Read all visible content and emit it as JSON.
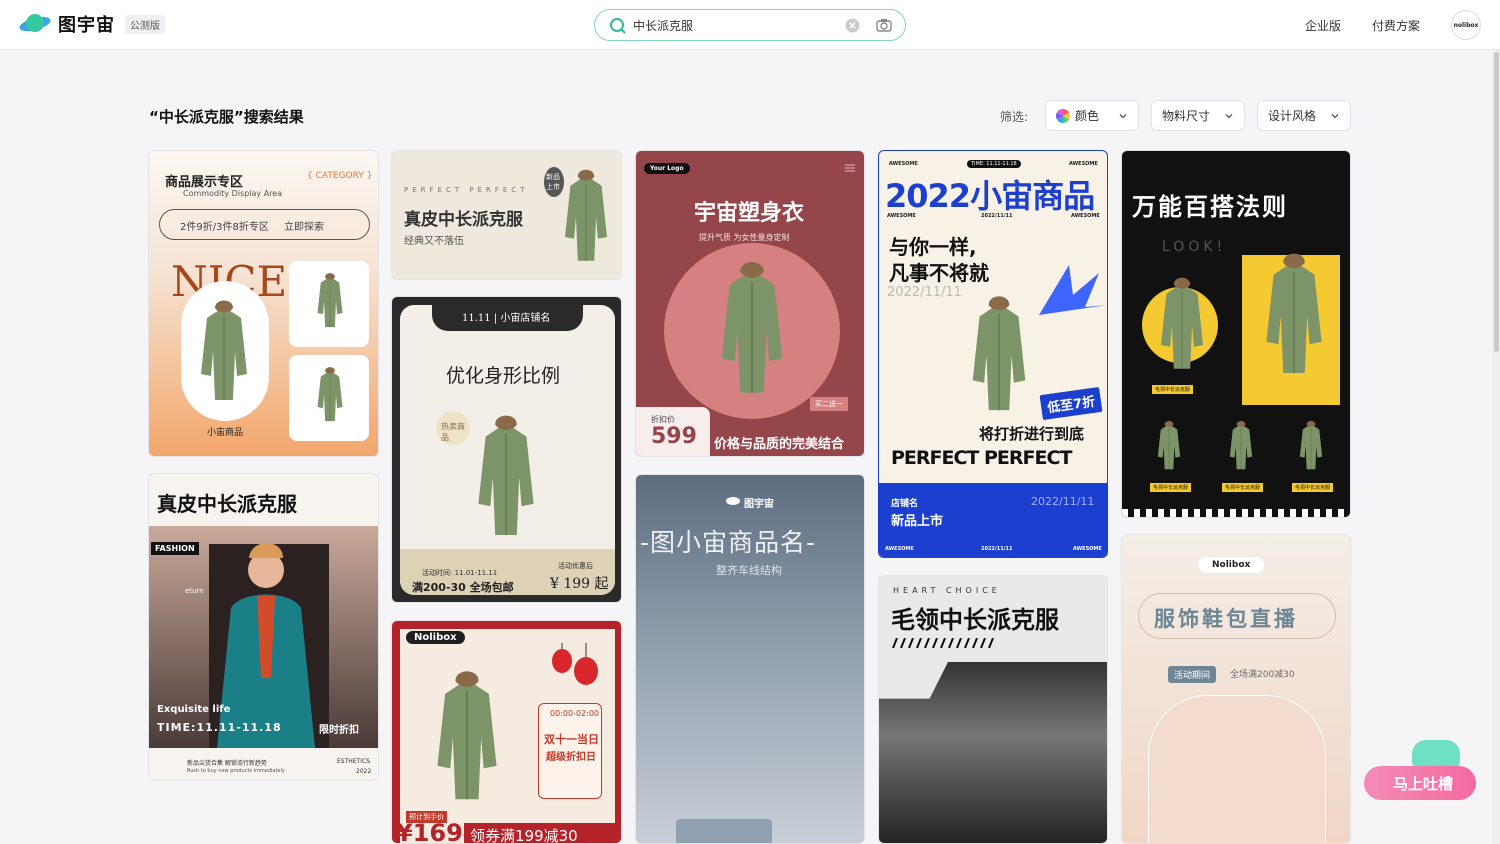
{
  "header": {
    "logo_text": "图宇宙",
    "beta_badge": "公测版",
    "search_value": "中长派克服",
    "nav_enterprise": "企业版",
    "nav_pricing": "付费方案",
    "avatar_text": "nolibox"
  },
  "results": {
    "title": "“中长派克服”搜索结果",
    "filter_label": "筛选:",
    "filters": [
      "颜色",
      "物料尺寸",
      "设计风格"
    ]
  },
  "cards": {
    "c1": {
      "heading": "商品展示专区",
      "sub": "Commodity Display Area",
      "category": "{ CATEGORY }",
      "pill_left": "2件9折/3件8折专区",
      "pill_right": "立即探索",
      "big": "NICE",
      "label": "小宙商品"
    },
    "c2": {
      "top": "PERFECT PERFECT",
      "heading": "真皮中长派克服",
      "sub": "经典又不落伍",
      "badge": "新品上市"
    },
    "c3": {
      "banner": "11.11 | 小宙店铺名",
      "heading": "优化身形比例",
      "tag": "热卖商品",
      "time": "活动时间: 11.01-11.11",
      "offer": "满200-30 全场包邮",
      "after": "活动优惠后",
      "price": "¥ 199 起"
    },
    "c4": {
      "brand": "Nolibox",
      "timer": "00:00-02:00",
      "line1": "双十一当日",
      "line2": "超级折扣日",
      "est": "预计到手价",
      "price": "¥169",
      "coupon": "领券满199减30"
    },
    "c5": {
      "logo": "Your Logo",
      "heading": "宇宙塑身衣",
      "sub": "提升气质 为女性量身定制",
      "tag": "买二送一",
      "price_label": "折扣价",
      "price": "599",
      "slogan": "价格与品质的完美结合"
    },
    "c6": {
      "brand": "图宇宙",
      "heading": "-图小宙商品名-",
      "sub": "整齐车线结构"
    },
    "c7": {
      "aw1": "AWESOME",
      "time": "TIME: 11.11-11.18",
      "aw2": "AWESOME",
      "heading": "2022小宙商品",
      "aw3": "AWESOME",
      "date": "2022/11/11",
      "aw4": "AWESOME",
      "line1": "与你一样,",
      "line2": "凡事不将就",
      "date2": "2022/11/11",
      "discount": "低至7折",
      "line3": "将打折进行到底",
      "perfect": "PERFECT PERFECT",
      "shop": "店铺名",
      "date3": "2022/11/11",
      "new": "新品上市",
      "aw5": "AWESOME",
      "date4": "2022/11/11",
      "aw6": "AWESOME"
    },
    "c8": {
      "top": "HEART CHOICE",
      "heading": "毛领中长派克服"
    },
    "c9": {
      "heading": "真皮中长派克服",
      "fashion": "FASHION",
      "return": "eturn",
      "life": "Exquisite life",
      "time": "TIME:11.11-11.18",
      "limited": "限时折扣",
      "f1": "新品尖货合集 解锁流行新趋势",
      "f2": "Rush to buy new products immediately",
      "f3": "ESTHETICS",
      "f4": "2022"
    },
    "c10": {
      "heading": "万能百搭法则",
      "look": "LOOK!",
      "tag1": "毛领中长派克服",
      "tag2": "毛领中长派克服",
      "tag3": "毛领中长派克服",
      "tag4": "毛领中长派克服"
    },
    "c11": {
      "brand": "Nolibox",
      "heading": "服饰鞋包直播",
      "period": "活动期间",
      "offer": "全场满200减30"
    }
  },
  "feedback": {
    "label": "马上吐槽"
  },
  "colors": {
    "accent": "#2fb89a",
    "green_coat": "#7d9468",
    "pink": "#f36aa0"
  },
  "icons": {
    "search": "search-icon",
    "clear": "clear-icon",
    "camera": "camera-icon",
    "chevron": "chevron-down-icon",
    "palette": "color-wheel-icon"
  }
}
